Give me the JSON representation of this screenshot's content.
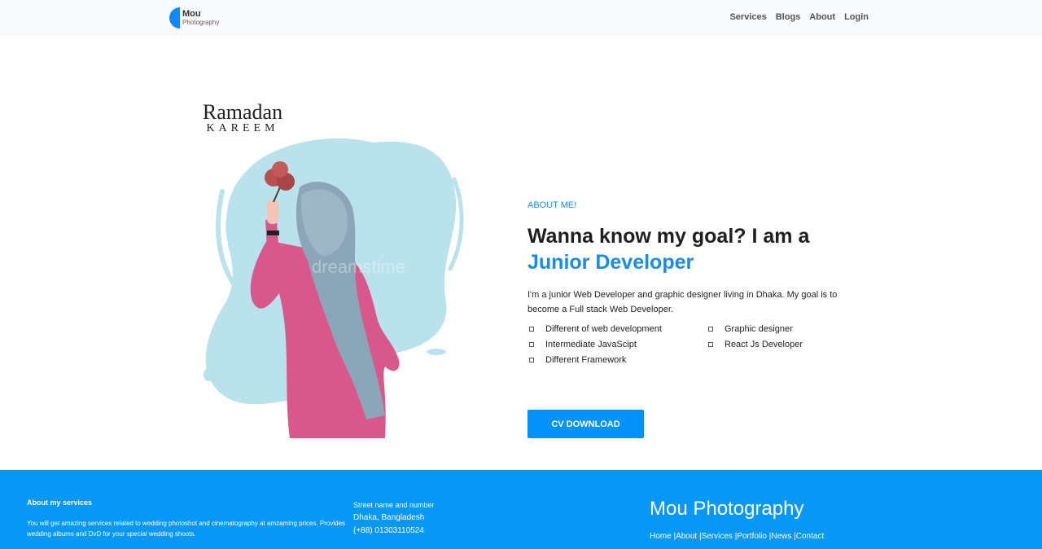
{
  "navbar": {
    "brand_name": "Mou",
    "brand_sub": "Photography",
    "links": [
      "Services",
      "Blogs",
      "About",
      "Login"
    ]
  },
  "hero": {
    "image_title_line1": "Ramadan",
    "image_title_line2": "KAREEM",
    "watermark": "dreamstime"
  },
  "about": {
    "eyebrow": "ABOUT ME!",
    "headline": "Wanna know my goal? I am a",
    "headline_accent": "Junior Developer",
    "intro": "I'm a junior Web Developer and graphic designer living in Dhaka. My goal is to become a Full stack Web Developer.",
    "skills": [
      "Different of web development",
      "Graphic designer",
      "Intermediate JavaScipt",
      "React Js Developer",
      "Different Framework"
    ],
    "cv_button": "CV DOWNLOAD"
  },
  "footer": {
    "services_title": "About my services",
    "services_desc": "You will get amazing services related to wedding photoshot and cinematography at amzaming prices. Provides wedding albums and DvD for your special wedding shoots.",
    "street": "Street name and number",
    "city": "Dhaka, Bangladesh",
    "phone": "(+88) 01303110524",
    "brand": "Mou Photography",
    "links": [
      "Home |",
      "About |",
      "Services |",
      "Portfolio |",
      "News |",
      "Contact"
    ]
  },
  "colors": {
    "accent": "#1a8be8",
    "footer_bg": "#0797f5",
    "navbar_bg": "#f8f9fa"
  }
}
